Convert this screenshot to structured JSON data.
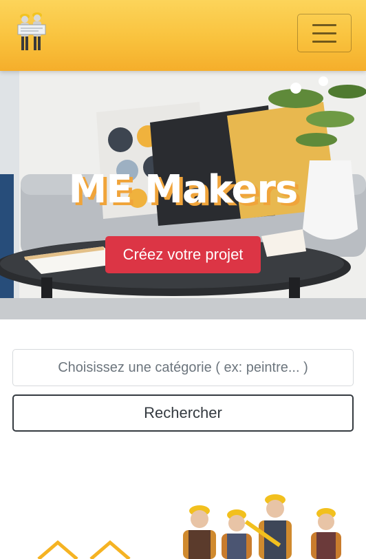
{
  "navbar": {
    "logo_icon": "construction-workers-logo-icon",
    "menu_icon": "hamburger-menu-icon",
    "accent_color": "#f9c23d"
  },
  "hero": {
    "title": "ME Makers",
    "cta_label": "Créez votre projet",
    "cta_color": "#dc3545"
  },
  "search": {
    "placeholder": "Choisissez une catégorie ( ex: peintre... )",
    "value": "",
    "button_label": "Rechercher"
  },
  "illustrations": {
    "left_icon": "house-outline-icon",
    "right_image": "construction-workers-image"
  }
}
